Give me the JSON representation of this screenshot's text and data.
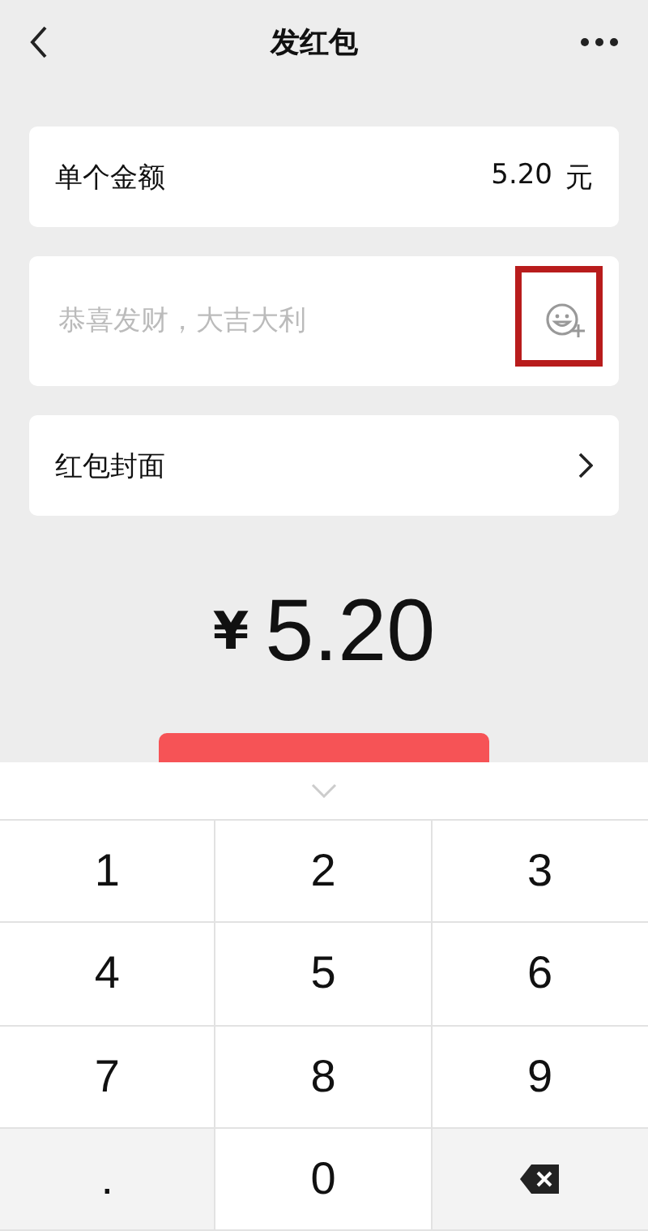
{
  "nav": {
    "title": "发红包"
  },
  "fields": [
    {
      "kind": "amount",
      "label": "单个金额",
      "value": "5.20",
      "unit": "元"
    },
    {
      "kind": "greeting",
      "placeholder": "恭喜发财，大吉大利",
      "highlighted": true
    },
    {
      "kind": "link",
      "label": "红包封面"
    }
  ],
  "total": {
    "currency": "¥",
    "amount": "5.20"
  },
  "keypad": {
    "keys": [
      {
        "kind": "digit",
        "label": "1"
      },
      {
        "kind": "digit",
        "label": "2"
      },
      {
        "kind": "digit",
        "label": "3"
      },
      {
        "kind": "digit",
        "label": "4"
      },
      {
        "kind": "digit",
        "label": "5"
      },
      {
        "kind": "digit",
        "label": "6"
      },
      {
        "kind": "digit",
        "label": "7"
      },
      {
        "kind": "digit",
        "label": "8"
      },
      {
        "kind": "digit",
        "label": "9"
      },
      {
        "kind": "symbol",
        "label": "."
      },
      {
        "kind": "digit",
        "label": "0"
      },
      {
        "kind": "backspace"
      }
    ]
  }
}
